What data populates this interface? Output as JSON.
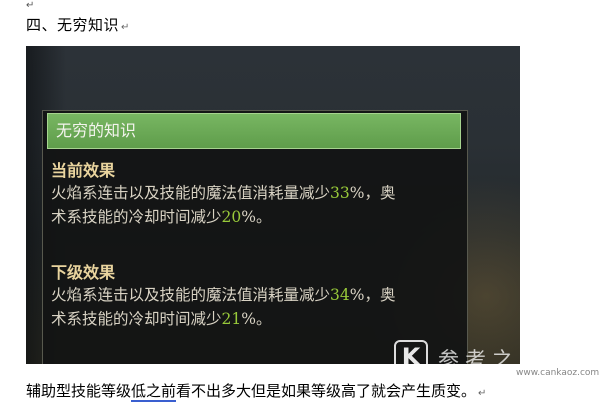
{
  "document": {
    "top_mark": "↵",
    "heading": "四、无穷知识",
    "para_mark": "↵",
    "footer_before": "辅助型技能等级",
    "footer_underlined": "低之前",
    "footer_after": "看不出多大但是如果等级高了就会产生质变。",
    "footer_mark": "↵"
  },
  "tooltip": {
    "title": "无穷的知识",
    "current": {
      "label": "当前效果",
      "line1_text": "火焰系连击以及技能的魔法值消耗量减少",
      "line1_value": "33",
      "line1_suffix": "%，奥",
      "line2_text": "术系技能的冷却时间减少",
      "line2_value": "20",
      "line2_suffix": "%。"
    },
    "next": {
      "label": "下级效果",
      "line1_text": "火焰系连击以及技能的魔法值消耗量减少",
      "line1_value": "34",
      "line1_suffix": "%，奥",
      "line2_text": "术系技能的冷却时间减少",
      "line2_value": "21",
      "line2_suffix": "%。"
    },
    "value_color": "#98c93a",
    "title_bar_color": "#6aaa55"
  },
  "watermark": {
    "logo": "K",
    "text": "参考之家",
    "url": "www.cankaoz.com"
  }
}
